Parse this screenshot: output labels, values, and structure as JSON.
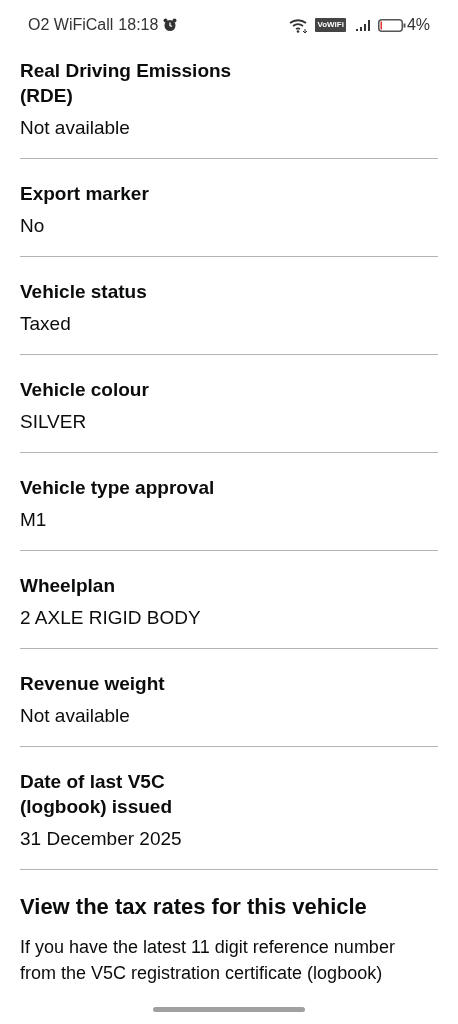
{
  "status_bar": {
    "carrier": "O2 WiFiCall",
    "time": "18:18",
    "vowifi": "VoWiFi",
    "battery": "4%"
  },
  "details": [
    {
      "label": "Real Driving Emissions (RDE)",
      "value": "Not available"
    },
    {
      "label": "Export marker",
      "value": "No"
    },
    {
      "label": "Vehicle status",
      "value": "Taxed"
    },
    {
      "label": "Vehicle colour",
      "value": "SILVER"
    },
    {
      "label": "Vehicle type approval",
      "value": "M1"
    },
    {
      "label": "Wheelplan",
      "value": "2 AXLE RIGID BODY"
    },
    {
      "label": "Revenue weight",
      "value": "Not available"
    },
    {
      "label": "Date of last V5C (logbook) issued",
      "value": "31 December 2025"
    }
  ],
  "tax_section": {
    "heading": "View the tax rates for this vehicle",
    "text": "If you have the latest 11 digit reference number from the V5C registration certificate (logbook)"
  }
}
